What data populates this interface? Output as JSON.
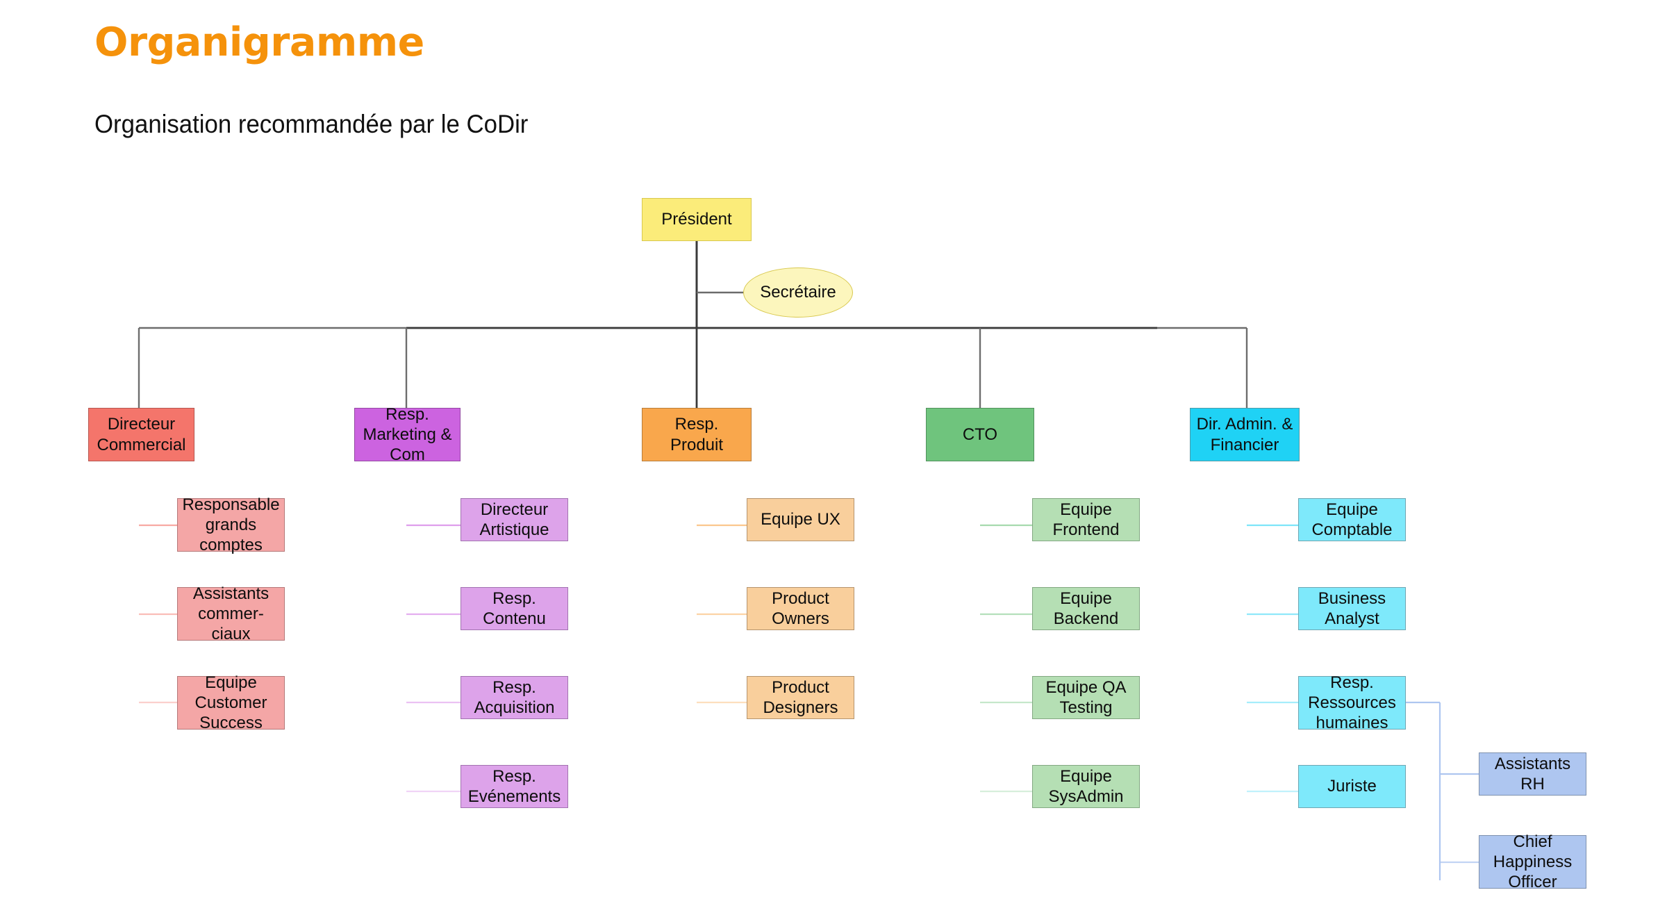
{
  "header": {
    "title": "Organigramme",
    "subtitle": "Organisation recommandée par le CoDir",
    "title_color": "#f5920b",
    "subtitle_color": "#111111"
  },
  "chart_data": {
    "type": "diagram",
    "diagram_kind": "organizational-chart",
    "title": "Organigramme",
    "subtitle": "Organisation recommandée par le CoDir",
    "orientation": "top-down with side branches",
    "root": "Président",
    "staff_node": "Secrétaire",
    "branch_count": 5,
    "node_count": 24
  },
  "nodes": {
    "president": {
      "label": "Président",
      "shape": "rect",
      "fill": "#fbec7a",
      "stroke": "#d8c84e"
    },
    "secretaire": {
      "label": "Secrétaire",
      "shape": "ellipse",
      "fill": "#fcf6bd",
      "stroke": "#d8c84e"
    },
    "dir_commercial": {
      "label": "Directeur\nCommercial",
      "fill": "#f4756b",
      "stroke": "#b5564f"
    },
    "resp_marketing": {
      "label": "Resp.\nMarketing &\nCom",
      "fill": "#cc63e0",
      "stroke": "#9348a2"
    },
    "resp_produit": {
      "label": "Resp.\nProduit",
      "fill": "#f9a74c",
      "stroke": "#b87c38"
    },
    "cto": {
      "label": "CTO",
      "fill": "#6fc47d",
      "stroke": "#51915c"
    },
    "dir_admin_fin": {
      "label": "Dir. Admin. &\nFinancier",
      "fill": "#1fd2f5",
      "stroke": "#4f9aa8"
    },
    "resp_grands_comptes": {
      "label": "Responsable\ngrands\ncomptes",
      "fill": "#f4a6a6",
      "stroke": "#b5797a"
    },
    "assistants_commerciaux": {
      "label": "Assistants\ncommer-\nciaux",
      "fill": "#f4a6a6",
      "stroke": "#b5797a"
    },
    "equipe_customer_success": {
      "label": "Equipe\nCustomer\nSuccess",
      "fill": "#f4a6a6",
      "stroke": "#b5797a"
    },
    "directeur_artistique": {
      "label": "Directeur\nArtistique",
      "fill": "#dda3ea",
      "stroke": "#a272b0"
    },
    "resp_contenu": {
      "label": "Resp.\nContenu",
      "fill": "#dda3ea",
      "stroke": "#a272b0"
    },
    "resp_acquisition": {
      "label": "Resp.\nAcquisition",
      "fill": "#dda3ea",
      "stroke": "#a272b0"
    },
    "resp_evenements": {
      "label": "Resp.\nEvénements",
      "fill": "#dda3ea",
      "stroke": "#a272b0"
    },
    "equipe_ux": {
      "label": "Equipe UX",
      "fill": "#f9cf9c",
      "stroke": "#b5946e"
    },
    "product_owners": {
      "label": "Product\nOwners",
      "fill": "#f9cf9c",
      "stroke": "#b5946e"
    },
    "product_designers": {
      "label": "Product\nDesigners",
      "fill": "#f9cf9c",
      "stroke": "#b5946e"
    },
    "equipe_frontend": {
      "label": "Equipe\nFrontend",
      "fill": "#b5dfb4",
      "stroke": "#83a882"
    },
    "equipe_backend": {
      "label": "Equipe\nBackend",
      "fill": "#b5dfb4",
      "stroke": "#83a882"
    },
    "equipe_qa": {
      "label": "Equipe QA\nTesting",
      "fill": "#b5dfb4",
      "stroke": "#83a882"
    },
    "equipe_sysadmin": {
      "label": "Equipe\nSysAdmin",
      "fill": "#b5dfb4",
      "stroke": "#83a882"
    },
    "equipe_comptable": {
      "label": "Equipe\nComptable",
      "fill": "#7ee9fb",
      "stroke": "#6fa6b2"
    },
    "business_analyst": {
      "label": "Business\nAnalyst",
      "fill": "#7ee9fb",
      "stroke": "#6fa6b2"
    },
    "resp_rh": {
      "label": "Resp.\nRessources\nhumaines",
      "fill": "#7ee9fb",
      "stroke": "#6fa6b2"
    },
    "juriste": {
      "label": "Juriste",
      "fill": "#7ee9fb",
      "stroke": "#6fa6b2"
    },
    "assistants_rh": {
      "label": "Assistants\nRH",
      "fill": "#aec6f0",
      "stroke": "#7e91ae"
    },
    "chief_happiness": {
      "label": "Chief\nHappiness\nOfficer",
      "fill": "#aec6f0",
      "stroke": "#7e91ae"
    }
  },
  "wire_colors": {
    "root": "#444444",
    "staff": "#6b6b6b",
    "commercial": "#f4756b",
    "marketing": "#cc63e0",
    "produit": "#f9a74c",
    "tech": "#6fc47d",
    "admin": "#1fd2f5",
    "rh": "#aec6f0"
  }
}
